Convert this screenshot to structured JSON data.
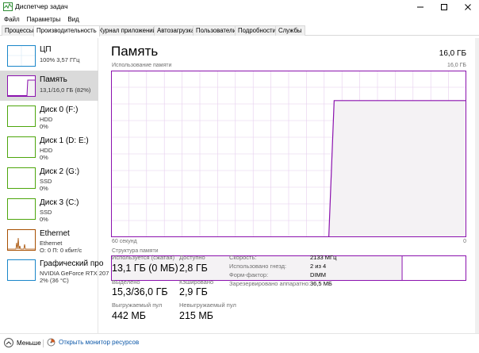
{
  "window": {
    "title": "Диспетчер задач"
  },
  "menu": [
    "Файл",
    "Параметры",
    "Вид"
  ],
  "tabs": [
    "Процессы",
    "Производительность",
    "Журнал приложений",
    "Автозагрузка",
    "Пользователи",
    "Подробности",
    "Службы"
  ],
  "active_tab": "Производительность",
  "sidebar": {
    "items": [
      {
        "name": "ЦП",
        "line1": "100%  3,57 ГГц",
        "line2": "",
        "kind": "cpu"
      },
      {
        "name": "Память",
        "line1": "13,1/16,0 ГБ (82%)",
        "line2": "",
        "kind": "memory",
        "selected": true
      },
      {
        "name": "Диск 0 (F:)",
        "line1": "HDD",
        "line2": "0%",
        "kind": "disk"
      },
      {
        "name": "Диск 1 (D: E:)",
        "line1": "HDD",
        "line2": "0%",
        "kind": "disk"
      },
      {
        "name": "Диск 2 (G:)",
        "line1": "SSD",
        "line2": "0%",
        "kind": "disk"
      },
      {
        "name": "Диск 3 (C:)",
        "line1": "SSD",
        "line2": "0%",
        "kind": "disk"
      },
      {
        "name": "Ethernet",
        "line1": "Ethernet",
        "line2": "О: 0  П: 0 кбит/с",
        "kind": "ethernet"
      },
      {
        "name": "Графический про",
        "line1": "NVIDIA GeForce RTX 207",
        "line2": "2% (36 °C)",
        "kind": "gpu"
      }
    ]
  },
  "panel": {
    "title": "Память",
    "total": "16,0 ГБ",
    "graph_caption": "Использование памяти",
    "graph_max": "16,0 ГБ",
    "graph_x_left": "60 секунд",
    "graph_x_right": "0",
    "struct_caption": "Структура памяти",
    "usage_fraction": 0.82,
    "struct_in_use_fraction": 0.82
  },
  "stats": {
    "in_use_label": "Используется (сжатая)",
    "in_use_value": "13,1 ГБ (0 МБ)",
    "available_label": "Доступно",
    "available_value": "2,8 ГБ",
    "committed_label": "Выделено",
    "committed_value": "15,3/36,0 ГБ",
    "cached_label": "Кэшировано",
    "cached_value": "2,9 ГБ",
    "paged_label": "Выгружаемый пул",
    "paged_value": "442 МБ",
    "nonpaged_label": "Невыгружаемый пул",
    "nonpaged_value": "215 МБ"
  },
  "specs": {
    "speed_label": "Скорость:",
    "speed_value": "2133 МГц",
    "slots_label": "Использовано гнезд:",
    "slots_value": "2 из 4",
    "form_label": "Форм-фактор:",
    "form_value": "DIMM",
    "reserved_label": "Зарезервировано аппаратно:",
    "reserved_value": "36,5 МБ"
  },
  "footer": {
    "fewer": "Меньше",
    "resmon": "Открыть монитор ресурсов"
  },
  "colors": {
    "memory": "#8b12ae",
    "memory_fill": "#f4f2f4",
    "cpu": "#1a86c9",
    "disk": "#4da60c",
    "ethernet": "#a74f01",
    "grid": "#e6cdee"
  }
}
